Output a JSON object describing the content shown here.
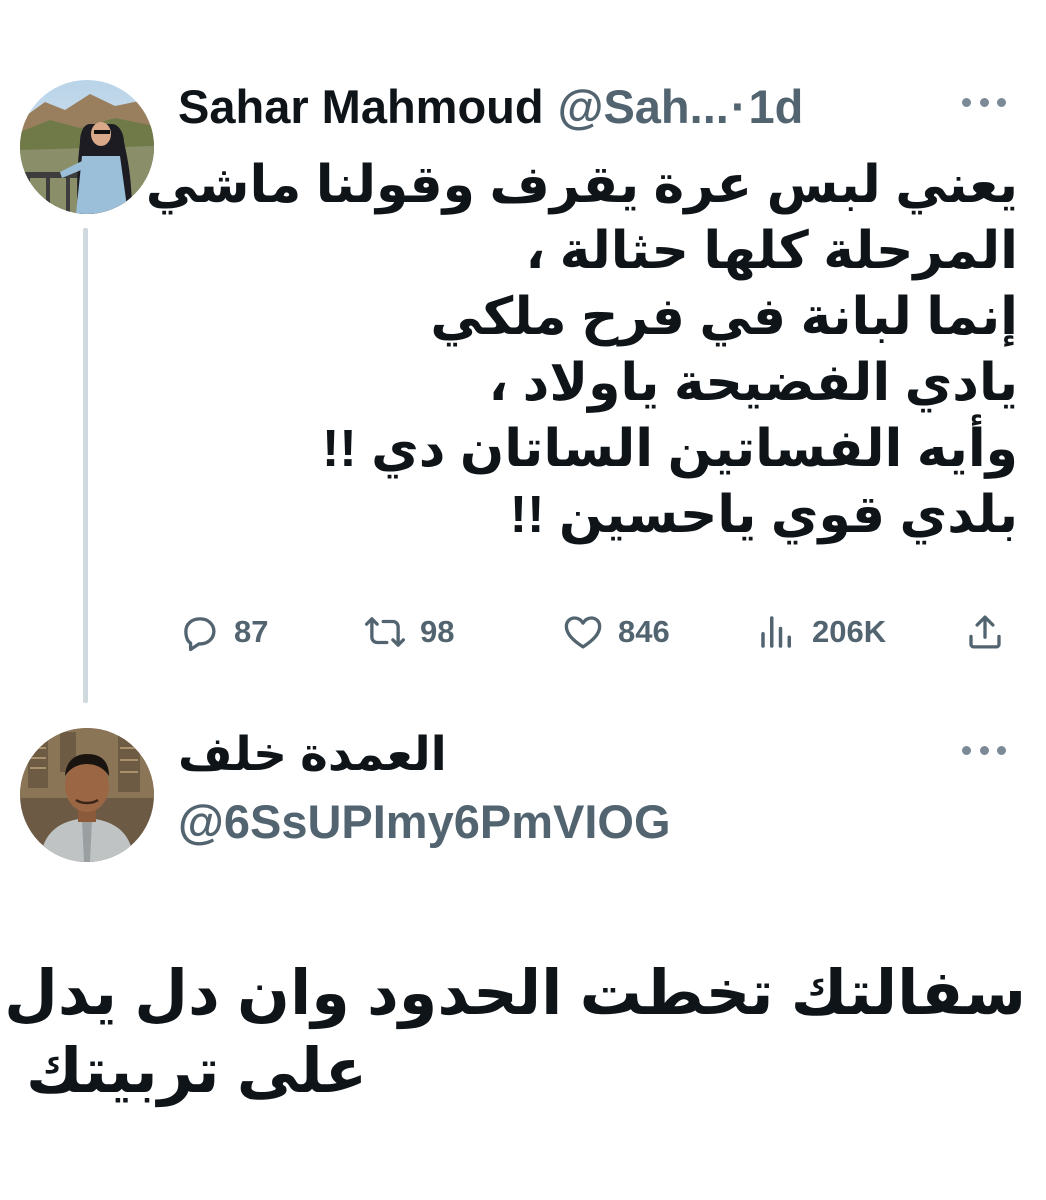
{
  "tweet": {
    "display_name": "Sahar Mahmoud",
    "handle": "@Sah...",
    "separator": "·",
    "time": "1d",
    "text_lines": [
      "يعني لبس عرة يقرف وقولنا ماشي",
      "المرحلة كلها حثالة ،",
      "إنما لبانة في فرح ملكي",
      "يادي الفضيحة ياولاد ،",
      "وأيه الفساتين الساتان دي !!",
      "بلدي قوي ياحسين !!"
    ],
    "actions": {
      "replies": "87",
      "retweets": "98",
      "likes": "846",
      "views": "206K"
    },
    "icons": {
      "reply": "reply-bubble-icon",
      "retweet": "retweet-icon",
      "like": "heart-icon",
      "views": "views-bar-icon",
      "share": "share-upload-icon",
      "more": "more-dots-icon"
    }
  },
  "reply": {
    "display_name": "العمدة خلف",
    "handle": "@6SsUPImy6PmVIOG",
    "text_lines": [
      "سفالتك تخطت الحدود وان دل يدل",
      "على تربيتك"
    ]
  },
  "colors": {
    "text_primary": "#0f1419",
    "text_secondary": "#536471",
    "thread_line": "#cfd9de",
    "background": "#ffffff"
  }
}
